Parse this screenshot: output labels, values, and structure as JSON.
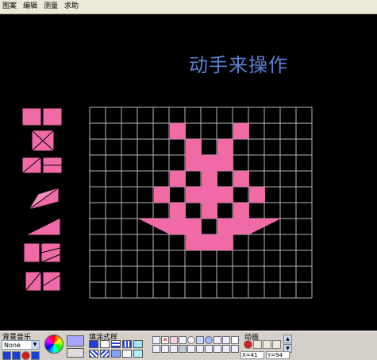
{
  "menu": {
    "items": [
      "图案",
      "编辑",
      "测量",
      "求助"
    ]
  },
  "title": "动手来操作",
  "colors": {
    "pink": "#f06aa8",
    "grid": "#b8b8b8",
    "title": "#5b82d6",
    "panel": "#d4d0c8"
  },
  "toolbar": {
    "bg_music_label": "背景音乐",
    "bg_music_value": "None",
    "fill_style_label": "填涂式样",
    "animation_label": "动画",
    "status_left": "X=41",
    "status_right": "Y=94"
  },
  "icons": [
    "stop-icon",
    "play-icon",
    "record-icon",
    "color-wheel-icon",
    "arrow-up-icon",
    "arrow-down-icon"
  ]
}
